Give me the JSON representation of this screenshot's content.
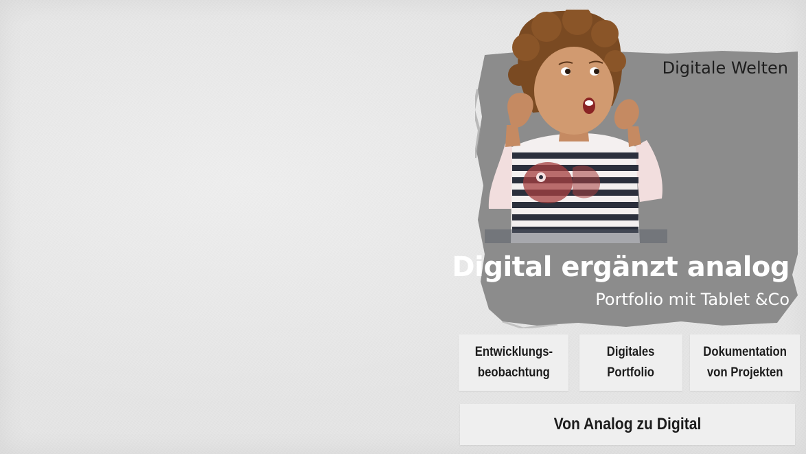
{
  "header": {
    "section_title": "Digitale Welten"
  },
  "hero": {
    "title": "Digital ergänzt analog",
    "subtitle": "Portfolio mit Tablet &Co",
    "panel_color": "#8c8c8c"
  },
  "tiles": [
    {
      "label": "Entwicklungs-\nbeobachtung"
    },
    {
      "label": "Digitales\nPortfolio"
    },
    {
      "label": "Dokumentation\nvon Projekten"
    }
  ],
  "wide_tile": {
    "label": "Von Analog zu Digital"
  },
  "colors": {
    "background": "#e6e6e6",
    "tile": "#efefef",
    "tile_text": "#1c1c1c",
    "hero_text": "#ffffff"
  }
}
